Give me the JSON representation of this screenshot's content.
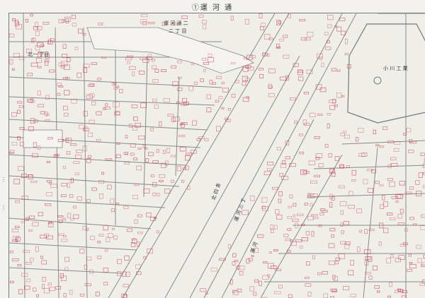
{
  "sheet": {
    "title": "①運 河 通"
  },
  "map": {
    "area_labels": {
      "unga_dori": "運 河 通 二",
      "chome_a": "ニ 丁 目",
      "kita_ichome": "北一 丁目",
      "factory": "小 川 工 業",
      "road_vertical_1": "北 四 条",
      "road_vertical_2": "運 河 三 丁",
      "road_vertical_3": "運 河"
    },
    "colors": {
      "building": "#c8475e",
      "street": "#8a8a8a",
      "paper": "#efeee9",
      "text": "#333333"
    }
  }
}
